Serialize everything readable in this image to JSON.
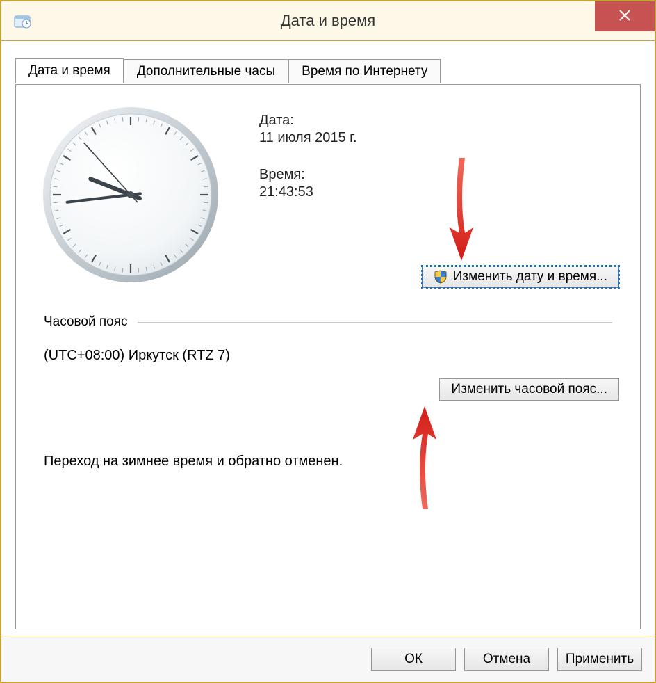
{
  "window": {
    "title": "Дата и время"
  },
  "tabs": {
    "t0": "Дата и время",
    "t1": "Дополнительные часы",
    "t2": "Время по Интернету"
  },
  "panel": {
    "date_label": "Дата:",
    "date_value": "11 июля 2015 г.",
    "time_label": "Время:",
    "time_value": "21:43:53",
    "change_datetime_btn": "Изменить дату и время...",
    "tz_header": "Часовой пояс",
    "tz_value": "(UTC+08:00) Иркутск (RTZ 7)",
    "change_tz_btn": "Изменить часовой пояс...",
    "change_tz_btn_pre": "Изменить часовой по",
    "change_tz_btn_ul": "я",
    "change_tz_btn_post": "с...",
    "dst_note": "Переход на зимнее время и обратно отменен."
  },
  "footer": {
    "ok": "ОК",
    "cancel": "Отмена",
    "apply_pre": "П",
    "apply_ul": "р",
    "apply_post": "именить"
  },
  "clock": {
    "hour": 21,
    "minute": 43,
    "second": 53
  }
}
